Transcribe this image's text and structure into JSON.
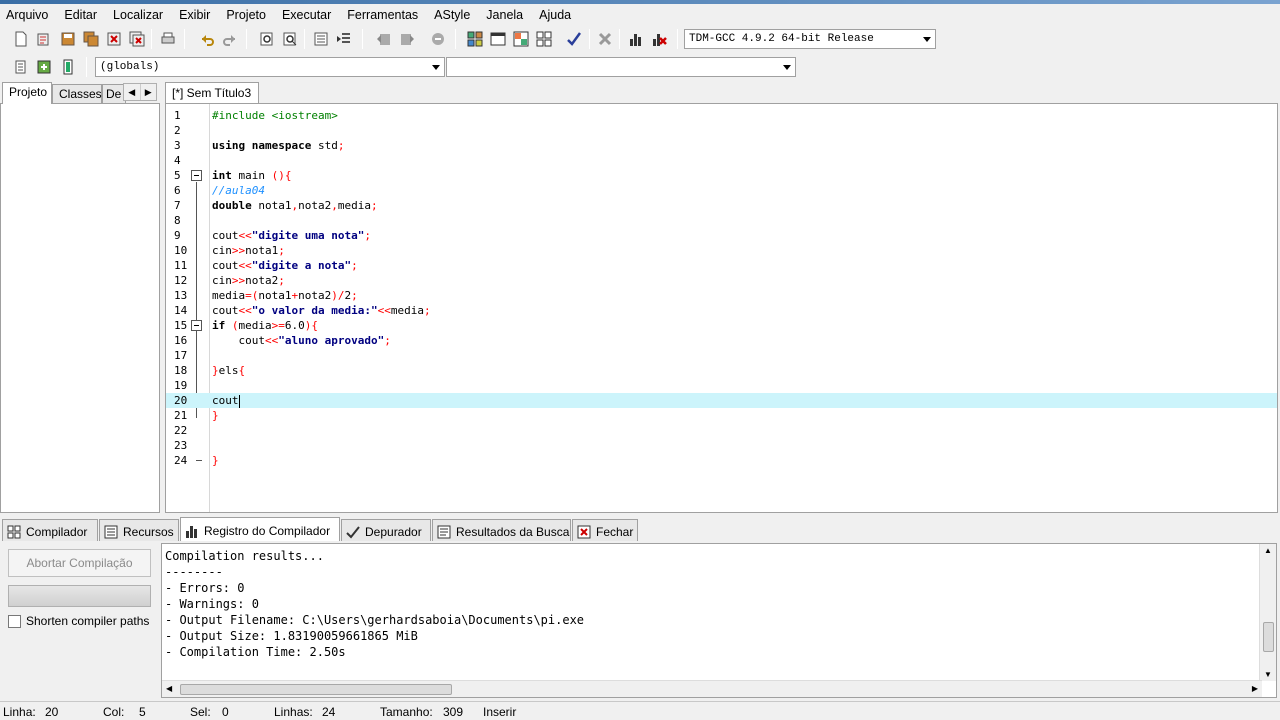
{
  "menu": [
    "Arquivo",
    "Editar",
    "Localizar",
    "Exibir",
    "Projeto",
    "Executar",
    "Ferramentas",
    "AStyle",
    "Janela",
    "Ajuda"
  ],
  "toolbar": {
    "compiler_select": "TDM-GCC 4.9.2 64-bit Release",
    "scope_select": "(globals)",
    "member_select": ""
  },
  "left_tabs": [
    "Projeto",
    "Classes",
    "De"
  ],
  "editor_tab": "[*] Sem Título3",
  "code_lines": [
    {
      "n": "1"
    },
    {
      "n": "2"
    },
    {
      "n": "3"
    },
    {
      "n": "4"
    },
    {
      "n": "5"
    },
    {
      "n": "6"
    },
    {
      "n": "7"
    },
    {
      "n": "8"
    },
    {
      "n": "9"
    },
    {
      "n": "10"
    },
    {
      "n": "11"
    },
    {
      "n": "12"
    },
    {
      "n": "13"
    },
    {
      "n": "14"
    },
    {
      "n": "15"
    },
    {
      "n": "16"
    },
    {
      "n": "17"
    },
    {
      "n": "18"
    },
    {
      "n": "19"
    },
    {
      "n": "20"
    },
    {
      "n": "21"
    },
    {
      "n": "22"
    },
    {
      "n": "23"
    },
    {
      "n": "24"
    }
  ],
  "code": {
    "l1": "#include <iostream>",
    "l3_kw": "using namespace",
    "l3_rest": " std",
    "l5_kw": "int",
    "l5_rest": " main ",
    "l6": "//aula04",
    "l7_kw": "double",
    "l7_a": " nota1",
    "l7_b": "nota2",
    "l7_c": "media",
    "l9_a": "cout",
    "l9_s": "\"digite uma nota\"",
    "l10_a": "cin",
    "l10_b": "nota1",
    "l11_a": "cout",
    "l11_s": "\"digite a nota\"",
    "l12_a": "cin",
    "l12_b": "nota2",
    "l13_a": "media",
    "l13_b": "nota1",
    "l13_c": "nota2",
    "l13_d": "2",
    "l14_a": "cout",
    "l14_s": "\"o valor da media:\"",
    "l14_b": "media",
    "l15_kw": "if",
    "l15_a": "media",
    "l15_b": "6.0",
    "l16_a": "    cout",
    "l16_s": "\"aluno aprovado\"",
    "l18_a": "els",
    "l20_a": "cout"
  },
  "bottom_tabs": [
    "Compilador",
    "Recursos",
    "Registro do Compilador",
    "Depurador",
    "Resultados da Busca",
    "Fechar"
  ],
  "abort_button": "Abortar Compilação",
  "shorten_paths": "Shorten compiler paths",
  "log": [
    "Compilation results...",
    "--------",
    "- Errors: 0",
    "- Warnings: 0",
    "- Output Filename: C:\\Users\\gerhardsaboia\\Documents\\pi.exe",
    "- Output Size: 1.83190059661865 MiB",
    "- Compilation Time: 2.50s"
  ],
  "status": {
    "linha_label": "Linha:",
    "linha": "20",
    "col_label": "Col:",
    "col": "5",
    "sel_label": "Sel:",
    "sel": "0",
    "linhas_label": "Linhas:",
    "linhas": "24",
    "tamanho_label": "Tamanho:",
    "tamanho": "309",
    "mode": "Inserir"
  }
}
